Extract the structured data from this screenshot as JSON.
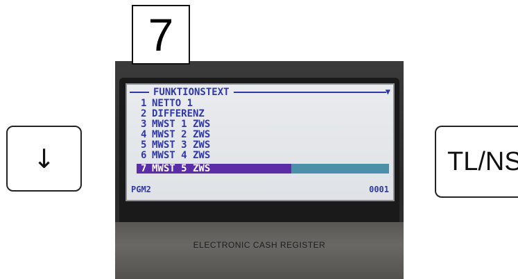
{
  "step_label": "7",
  "keys": {
    "down_symbol": "↓",
    "total_label": "TL/NS"
  },
  "lcd": {
    "title": "FUNKTIONSTEXT",
    "scroll_indicator": "▼",
    "items": [
      {
        "num": "1",
        "text": "NETTO 1"
      },
      {
        "num": "2",
        "text": "DIFFERENZ"
      },
      {
        "num": "3",
        "text": "MWST 1 ZWS"
      },
      {
        "num": "4",
        "text": "MWST 2 ZWS"
      },
      {
        "num": "5",
        "text": "MWST 3 ZWS"
      },
      {
        "num": "6",
        "text": "MWST 4 ZWS"
      },
      {
        "num": "7",
        "text": "MWST 5 ZWS"
      }
    ],
    "selected_index": 6,
    "footer_left": "PGM2",
    "footer_right": "0001"
  },
  "device_label": "ELECTRONIC CASH REGISTER"
}
